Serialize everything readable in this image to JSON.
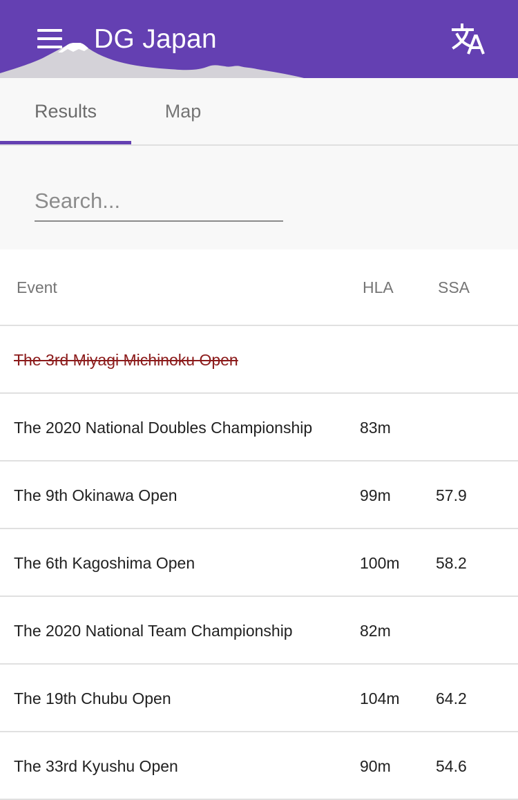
{
  "app": {
    "title": "DG Japan",
    "brand_color": "#6440b2"
  },
  "tabs": [
    {
      "label": "Results",
      "active": true
    },
    {
      "label": "Map",
      "active": false
    }
  ],
  "search": {
    "placeholder": "Search...",
    "value": ""
  },
  "table": {
    "headers": {
      "event": "Event",
      "hla": "HLA",
      "ssa": "SSA"
    },
    "rows": [
      {
        "event": "The 3rd Miyagi Michinoku Open",
        "hla": "",
        "ssa": "",
        "cancelled": true
      },
      {
        "event": "The 2020 National Doubles Championship",
        "hla": "83m",
        "ssa": ""
      },
      {
        "event": "The 9th Okinawa Open",
        "hla": "99m",
        "ssa": "57.9"
      },
      {
        "event": "The 6th Kagoshima Open",
        "hla": "100m",
        "ssa": "58.2"
      },
      {
        "event": "The 2020 National Team Championship",
        "hla": "82m",
        "ssa": ""
      },
      {
        "event": "The 19th Chubu Open",
        "hla": "104m",
        "ssa": "64.2"
      },
      {
        "event": "The 33rd Kyushu Open",
        "hla": "90m",
        "ssa": "54.6"
      }
    ]
  },
  "icons": {
    "menu": "menu-icon",
    "translate": "translate-icon",
    "background": "mount-fuji-silhouette"
  },
  "colors": {
    "cancelled_text": "#8b1a1a",
    "tab_indicator": "#6440b2"
  }
}
